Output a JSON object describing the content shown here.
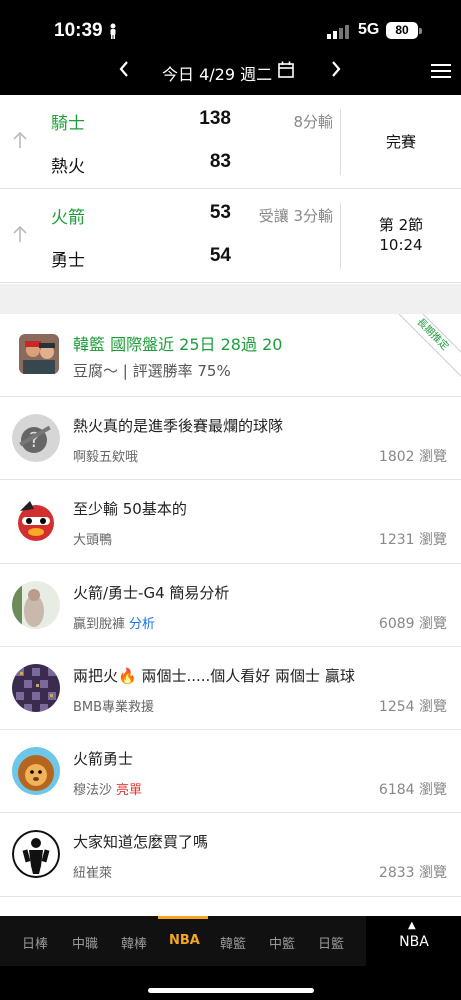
{
  "status": {
    "time": "10:39",
    "network": "5G",
    "battery": "80"
  },
  "datebar": {
    "label": "今日 4/29 週二"
  },
  "games": [
    {
      "team1": "騎士",
      "score1": "138",
      "team2": "熱火",
      "score2": "83",
      "note": "8分輸",
      "status_line1": "完賽",
      "status_line2": ""
    },
    {
      "team1": "火箭",
      "score1": "53",
      "team2": "勇士",
      "score2": "54",
      "note": "受讓 3分輸",
      "status_line1": "第 2節",
      "status_line2": "10:24"
    }
  ],
  "featured": {
    "title": "韓籃 國際盤近 25日 28過 20",
    "subtitle": "豆腐～ | 評選勝率 75%",
    "ribbon": "長期推定"
  },
  "posts": [
    {
      "title": "熱火真的是進季後賽最爛的球隊",
      "author": "啊毅五欸哦",
      "tag": "",
      "views": "1802 瀏覽"
    },
    {
      "title": "至少輸 50基本的",
      "author": "大頭鴨",
      "tag": "",
      "views": "1231 瀏覽"
    },
    {
      "title": "火箭/勇士-G4 簡易分析",
      "author": "贏到脫褲",
      "tag": "分析",
      "views": "6089 瀏覽"
    },
    {
      "title": "兩把火🔥 兩個士.....個人看好 兩個士 贏球",
      "author": "BMB專業救援",
      "tag": "",
      "views": "1254 瀏覽"
    },
    {
      "title": "火箭勇士",
      "author": "穆法沙",
      "tag": "亮單",
      "views": "6184 瀏覽"
    },
    {
      "title": "大家知道怎麼買了嗎",
      "author": "紐崔萊",
      "tag": "",
      "views": "2833 瀏覽"
    }
  ],
  "tabs": [
    "日棒",
    "中職",
    "韓棒",
    "NBA",
    "韓籃",
    "中籃",
    "日籃"
  ],
  "active_tab": "NBA",
  "right_tab": "NBA",
  "colors": {
    "win": "#1e9e3a",
    "accent": "#f5a623",
    "tag_blue": "#1a73e8",
    "tag_red": "#e53935"
  }
}
